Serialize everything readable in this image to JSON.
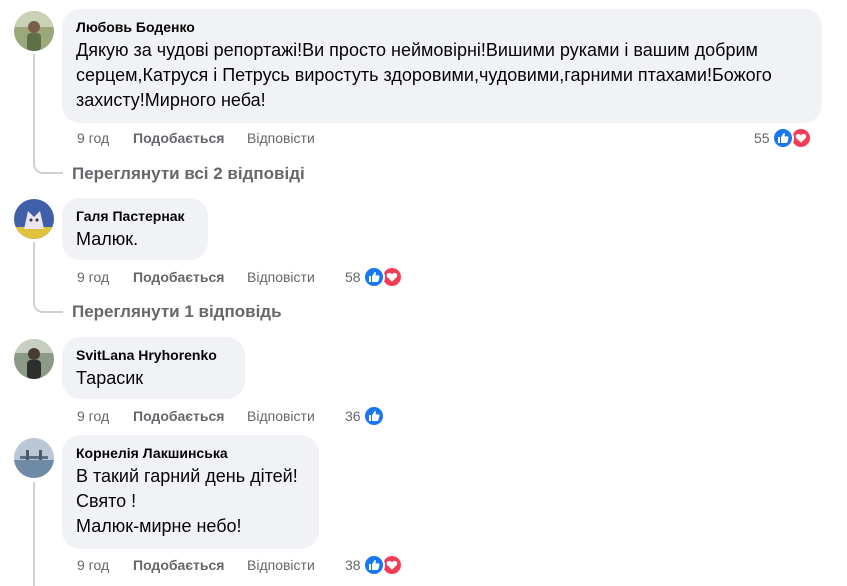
{
  "comments": [
    {
      "author": "Любовь Боденко",
      "text": "Дякую за чудові репортажі!Ви просто неймовірні!Вишими руками і вашим добрим\nсерцем,Катруся і Петрусь виростуть здоровими,чудовими,гарними птахами!Божого\nзахисту!Мирного неба!",
      "time": "9 год",
      "like_label": "Подобається",
      "reply_label": "Відповісти",
      "reaction_count": "55",
      "reactions": [
        "like-icon",
        "love-icon"
      ],
      "view_replies": "Переглянути всі 2 відповіді"
    },
    {
      "author": "Галя Пастернак",
      "text": "Малюк.",
      "time": "9 год",
      "like_label": "Подобається",
      "reply_label": "Відповісти",
      "reaction_count": "58",
      "reactions": [
        "like-icon",
        "love-icon"
      ],
      "view_replies": "Переглянути 1 відповідь"
    },
    {
      "author": "SvitLana Hryhorenko",
      "text": "Тарасик",
      "time": "9 год",
      "like_label": "Подобається",
      "reply_label": "Відповісти",
      "reaction_count": "36",
      "reactions": [
        "like-icon"
      ]
    },
    {
      "author": "Корнелія Лакшинська",
      "text": "В такий гарний день дітей!\nСвято !\nМалюк-мирне небо!",
      "time": "9 год",
      "like_label": "Подобається",
      "reply_label": "Відповісти",
      "reaction_count": "38",
      "reactions": [
        "like-icon",
        "love-icon"
      ]
    }
  ],
  "colors": {
    "bubble": "#f0f2f5",
    "secondary_text": "#65676b",
    "like_blue": "#1877f2",
    "love_red": "#f33e58"
  }
}
